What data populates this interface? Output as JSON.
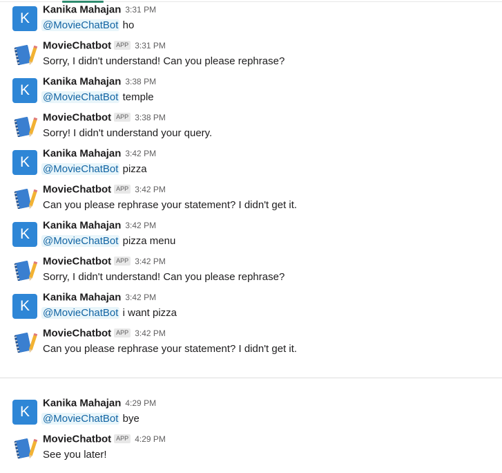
{
  "messages": [
    {
      "sender": "Kanika Mahajan",
      "avatar": "K",
      "time": "3:31 PM",
      "mention": "@MovieChatBot",
      "text": "ho"
    },
    {
      "sender": "MovieChatbot",
      "badge": "APP",
      "avatar_icon": "notebook-pencil-icon",
      "time": "3:31 PM",
      "text": "Sorry, I didn't understand! Can you please rephrase?"
    },
    {
      "sender": "Kanika Mahajan",
      "avatar": "K",
      "time": "3:38 PM",
      "mention": "@MovieChatBot",
      "text": "temple"
    },
    {
      "sender": "MovieChatbot",
      "badge": "APP",
      "avatar_icon": "notebook-pencil-icon",
      "time": "3:38 PM",
      "text": "Sorry! I didn't understand your query."
    },
    {
      "sender": "Kanika Mahajan",
      "avatar": "K",
      "time": "3:42 PM",
      "mention": "@MovieChatBot",
      "text": "pizza"
    },
    {
      "sender": "MovieChatbot",
      "badge": "APP",
      "avatar_icon": "notebook-pencil-icon",
      "time": "3:42 PM",
      "text": "Can you please rephrase your statement? I didn't get it."
    },
    {
      "sender": "Kanika Mahajan",
      "avatar": "K",
      "time": "3:42 PM",
      "mention": "@MovieChatBot",
      "text": "pizza menu"
    },
    {
      "sender": "MovieChatbot",
      "badge": "APP",
      "avatar_icon": "notebook-pencil-icon",
      "time": "3:42 PM",
      "text": "Sorry, I didn't understand! Can you please rephrase?"
    },
    {
      "sender": "Kanika Mahajan",
      "avatar": "K",
      "time": "3:42 PM",
      "mention": "@MovieChatBot",
      "text": "i want pizza"
    },
    {
      "sender": "MovieChatbot",
      "badge": "APP",
      "avatar_icon": "notebook-pencil-icon",
      "time": "3:42 PM",
      "text": "Can you please rephrase your statement? I didn't get it."
    },
    {
      "sender": "Kanika Mahajan",
      "avatar": "K",
      "time": "4:29 PM",
      "mention": "@MovieChatBot",
      "text": "bye"
    },
    {
      "sender": "MovieChatbot",
      "badge": "APP",
      "avatar_icon": "notebook-pencil-icon",
      "time": "4:29 PM",
      "text": "See you later!"
    }
  ],
  "colors": {
    "user_avatar": "#2e86d6",
    "mention_text": "#1264a3",
    "mention_bg": "#e8f5fa"
  }
}
